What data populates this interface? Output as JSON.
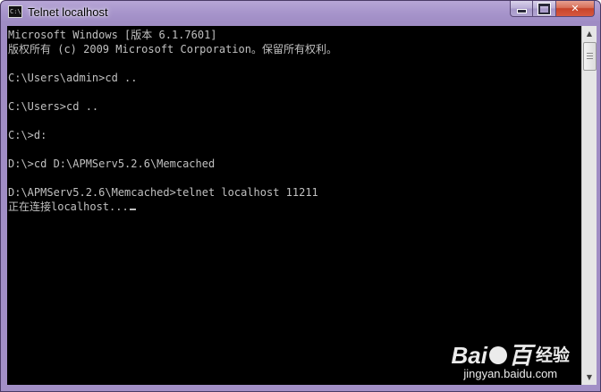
{
  "window": {
    "title": "Telnet localhost",
    "icon": "cmd-icon"
  },
  "console": {
    "lines": [
      "Microsoft Windows [版本 6.1.7601]",
      "版权所有 (c) 2009 Microsoft Corporation。保留所有权利。",
      "",
      "C:\\Users\\admin>cd ..",
      "",
      "C:\\Users>cd ..",
      "",
      "C:\\>d:",
      "",
      "D:\\>cd D:\\APMServ5.2.6\\Memcached",
      "",
      "D:\\APMServ5.2.6\\Memcached>telnet localhost 11211",
      "正在连接localhost..."
    ]
  },
  "watermark": {
    "brand_left": "Bai",
    "brand_right": "百",
    "product": "经验",
    "url": "jingyan.baidu.com"
  },
  "colors": {
    "console_bg": "#000000",
    "console_fg": "#c0c0c0",
    "titlebar": "#a896cc",
    "close_button": "#c7442a"
  }
}
